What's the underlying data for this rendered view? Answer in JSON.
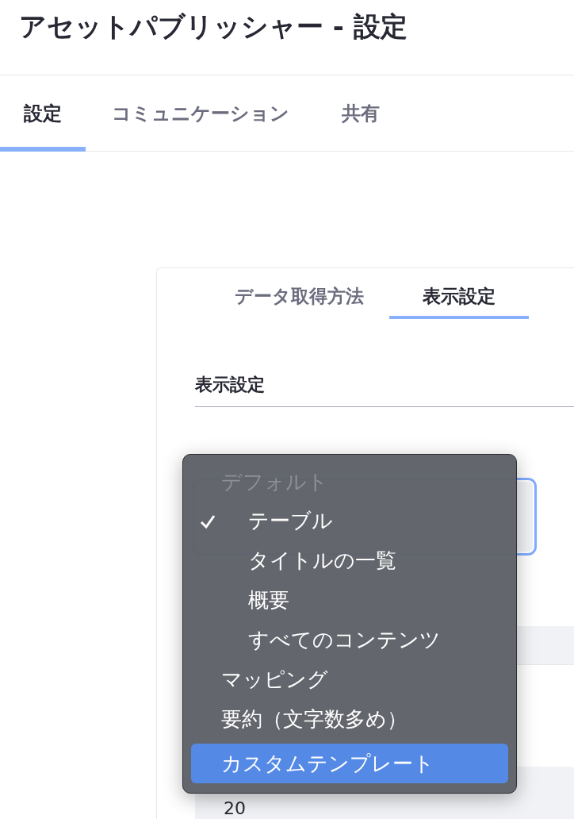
{
  "window": {
    "title": "アセットパブリッシャー - 設定"
  },
  "tabs": [
    {
      "label": "設定",
      "selected": true
    },
    {
      "label": "コミュニケーション",
      "selected": false
    },
    {
      "label": "共有",
      "selected": false
    }
  ],
  "panel": {
    "tabs": [
      {
        "label": "データ取得方法",
        "selected": false
      },
      {
        "label": "表示設定",
        "selected": true
      }
    ],
    "section_title": "表示設定",
    "count_field": {
      "value": "20"
    }
  },
  "menu": {
    "items": [
      {
        "label": "デフォルト",
        "kind": "group",
        "children": [
          {
            "label": "テーブル",
            "kind": "option",
            "checked": true,
            "highlighted": false
          },
          {
            "label": "タイトルの一覧",
            "kind": "option",
            "checked": false,
            "highlighted": false
          },
          {
            "label": "概要",
            "kind": "option",
            "checked": false,
            "highlighted": false
          },
          {
            "label": "すべてのコンテンツ",
            "kind": "option",
            "checked": false,
            "highlighted": false
          }
        ]
      },
      {
        "label": "マッピング",
        "kind": "option",
        "checked": false,
        "highlighted": false
      },
      {
        "label": "要約（文字数多め）",
        "kind": "option",
        "checked": false,
        "highlighted": false
      },
      {
        "label": "カスタムテンプレート",
        "kind": "option",
        "checked": false,
        "highlighted": true
      }
    ]
  }
}
